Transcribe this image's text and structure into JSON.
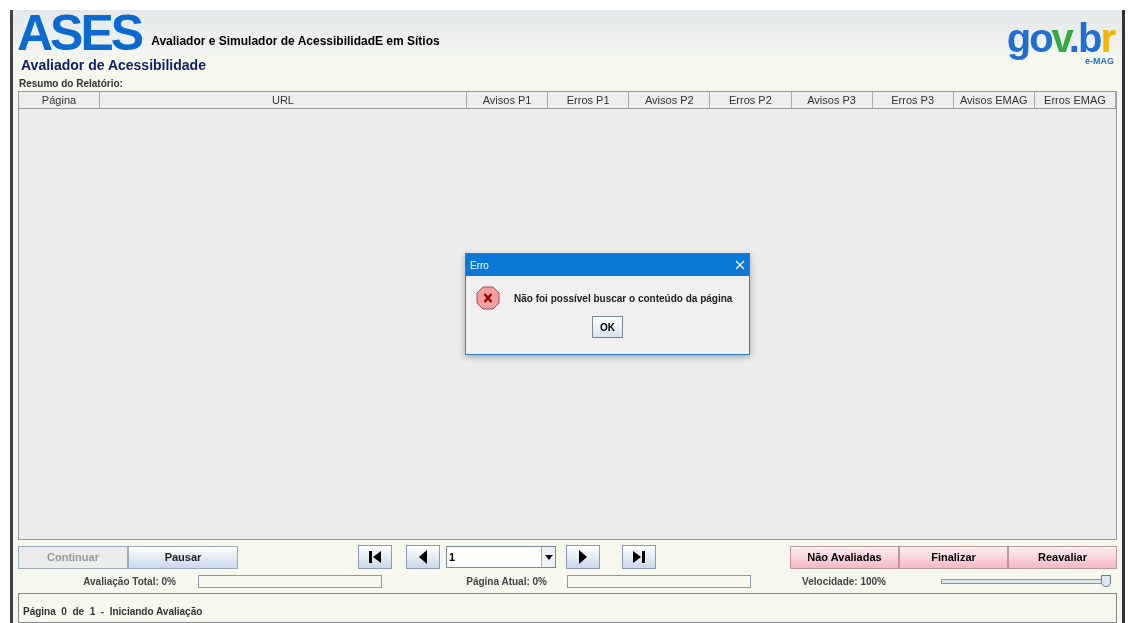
{
  "header": {
    "logo": "ASES",
    "subtitle": "Avaliador e Simulador de AcessibilidadE em Sítios",
    "brand": "gov.br",
    "brand_sub": "e-MAG",
    "title": "Avaliador de Acessibilidade"
  },
  "report": {
    "label": "Resumo do Relatório:",
    "columns": [
      "Página",
      "URL",
      "Avisos P1",
      "Erros P1",
      "Avisos P2",
      "Erros P2",
      "Avisos P3",
      "Erros P3",
      "Avisos EMAG",
      "Erros EMAG"
    ]
  },
  "controls": {
    "buttons": [
      {
        "label": "Continuar",
        "disabled": true
      },
      {
        "label": "Pausar",
        "disabled": false
      }
    ],
    "page_select": {
      "value": "1"
    },
    "actions": [
      {
        "label": "Não Avaliadas"
      },
      {
        "label": "Finalizar"
      },
      {
        "label": "Reavaliar"
      }
    ]
  },
  "progress": {
    "total": {
      "label": "Avaliação Total: 0%",
      "level": 0
    },
    "page": {
      "label": "Página Atual: 0%",
      "level": 0
    },
    "speed": {
      "label": "Velocidade: 100%",
      "level": 1
    }
  },
  "status": "Página  0  de  1  -  Iniciando Avaliação",
  "dialog": {
    "title": "Erro",
    "message": "Não foi possível buscar o conteúdo da página",
    "button": "OK"
  }
}
